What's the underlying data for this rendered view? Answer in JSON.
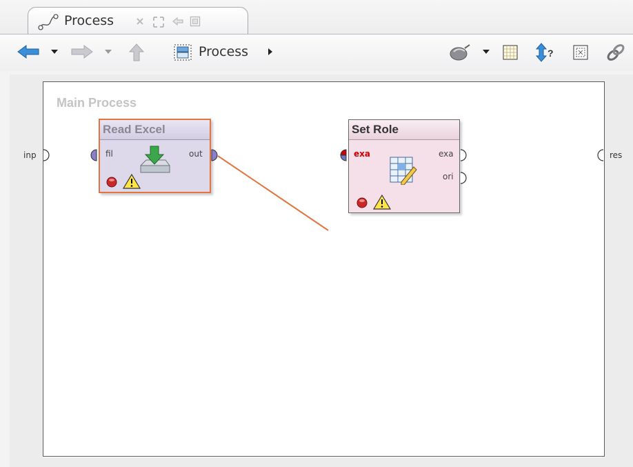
{
  "tab": {
    "title": "Process",
    "icon": "process-curve-icon",
    "buttons": [
      "close-icon",
      "maximize-icon",
      "restore-icon",
      "detach-icon"
    ]
  },
  "toolbar": {
    "breadcrumb_label": "Process",
    "left_icons": [
      "back-arrow-icon",
      "back-dropdown-icon",
      "forward-arrow-icon",
      "forward-dropdown-icon",
      "up-arrow-icon",
      "process-window-icon",
      "breadcrumb-expand-icon"
    ],
    "right_icons": [
      "auto-wire-icon",
      "auto-wire-dropdown-icon",
      "arrange-grid-icon",
      "execution-order-icon",
      "fit-zoom-icon",
      "link-icon"
    ]
  },
  "canvas": {
    "title": "Main Process",
    "left_port": "inp",
    "right_port": "res"
  },
  "operators": {
    "read_excel": {
      "name": "Read Excel",
      "input_port": "fil",
      "output_port": "out"
    },
    "set_role": {
      "name": "Set Role",
      "input_port": "exa",
      "output_port_1": "exa",
      "output_port_2": "ori"
    }
  },
  "colors": {
    "selection_border": "#e4743f",
    "wire": "#e4743f",
    "read_excel_body": "#ded9ea",
    "set_role_body": "#f5dfe8",
    "error_input": "#cc0000",
    "port_purple": "#8c7fc8"
  }
}
